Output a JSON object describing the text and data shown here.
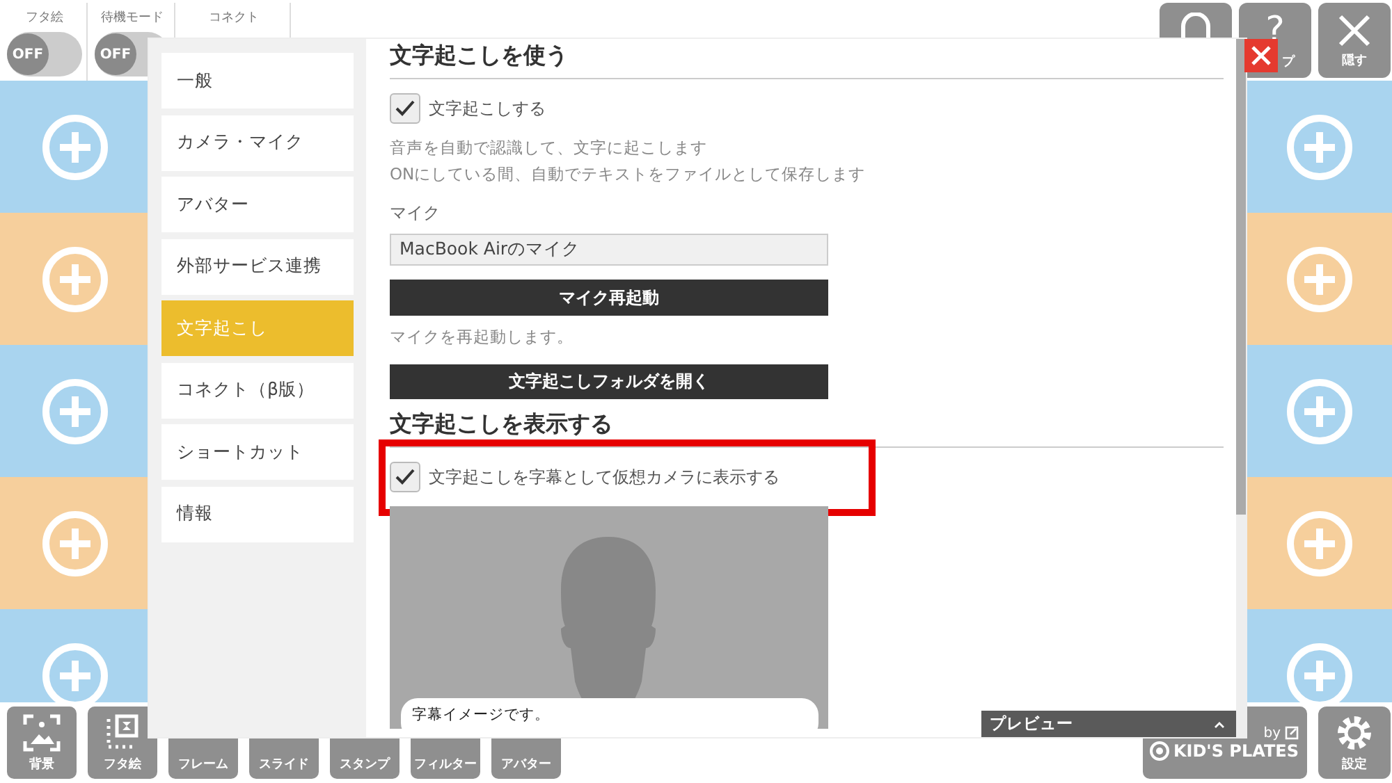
{
  "top_bar": {
    "toggles": [
      {
        "label": "フタ絵",
        "state_text": "OFF",
        "on": false
      },
      {
        "label": "待機モード",
        "state_text": "OFF",
        "on": false
      }
    ],
    "connect_label": "コネクト",
    "buttons": [
      {
        "kind": "home"
      },
      {
        "kind": "help",
        "icon_text": "?",
        "label": "プ"
      },
      {
        "kind": "hide",
        "label": "隠す"
      }
    ]
  },
  "bottom_bar": {
    "tools": [
      {
        "kind": "background",
        "label": "背景"
      },
      {
        "kind": "lid",
        "label": "フタ絵"
      },
      {
        "kind": "other",
        "label": "フレーム"
      },
      {
        "kind": "other",
        "label": "スライド"
      },
      {
        "kind": "other",
        "label": "スタンプ"
      },
      {
        "kind": "other",
        "label": "フィルター"
      },
      {
        "kind": "other",
        "label": "アバター"
      }
    ],
    "brand": {
      "by": "by",
      "name": "KID'S PLATES"
    },
    "settings_label": "設定"
  },
  "settings_dialog": {
    "sidebar": {
      "items": [
        {
          "label": "一般",
          "selected": false
        },
        {
          "label": "カメラ・マイク",
          "selected": false
        },
        {
          "label": "アバター",
          "selected": false
        },
        {
          "label": "外部サービス連携",
          "selected": false
        },
        {
          "label": "文字起こし",
          "selected": true
        },
        {
          "label": "コネクト（β版）",
          "selected": false
        },
        {
          "label": "ショートカット",
          "selected": false
        },
        {
          "label": "情報",
          "selected": false
        }
      ]
    },
    "sections": [
      {
        "title": "文字起こしを使う",
        "items": [
          {
            "kind": "checkbox",
            "label": "文字起こしする",
            "checked": true,
            "highlighted": false
          },
          {
            "kind": "description",
            "lines": [
              "音声を自動で認識して、文字に起こします",
              "ONにしている間、自動でテキストをファイルとして保存します"
            ]
          },
          {
            "kind": "label",
            "text": "マイク"
          },
          {
            "kind": "select",
            "value": "MacBook Airのマイク"
          },
          {
            "kind": "button",
            "label": "マイク再起動"
          },
          {
            "kind": "note",
            "text": "マイクを再起動します。"
          },
          {
            "kind": "button",
            "label": "文字起こしフォルダを開く"
          }
        ]
      },
      {
        "title": "文字起こしを表示する",
        "items": [
          {
            "kind": "checkbox",
            "label": "文字起こしを字幕として仮想カメラに表示する",
            "checked": true,
            "highlighted": true
          },
          {
            "kind": "preview",
            "caption": "字幕イメージです。"
          }
        ]
      }
    ],
    "preview_panel": {
      "label": "プレビュー"
    }
  }
}
